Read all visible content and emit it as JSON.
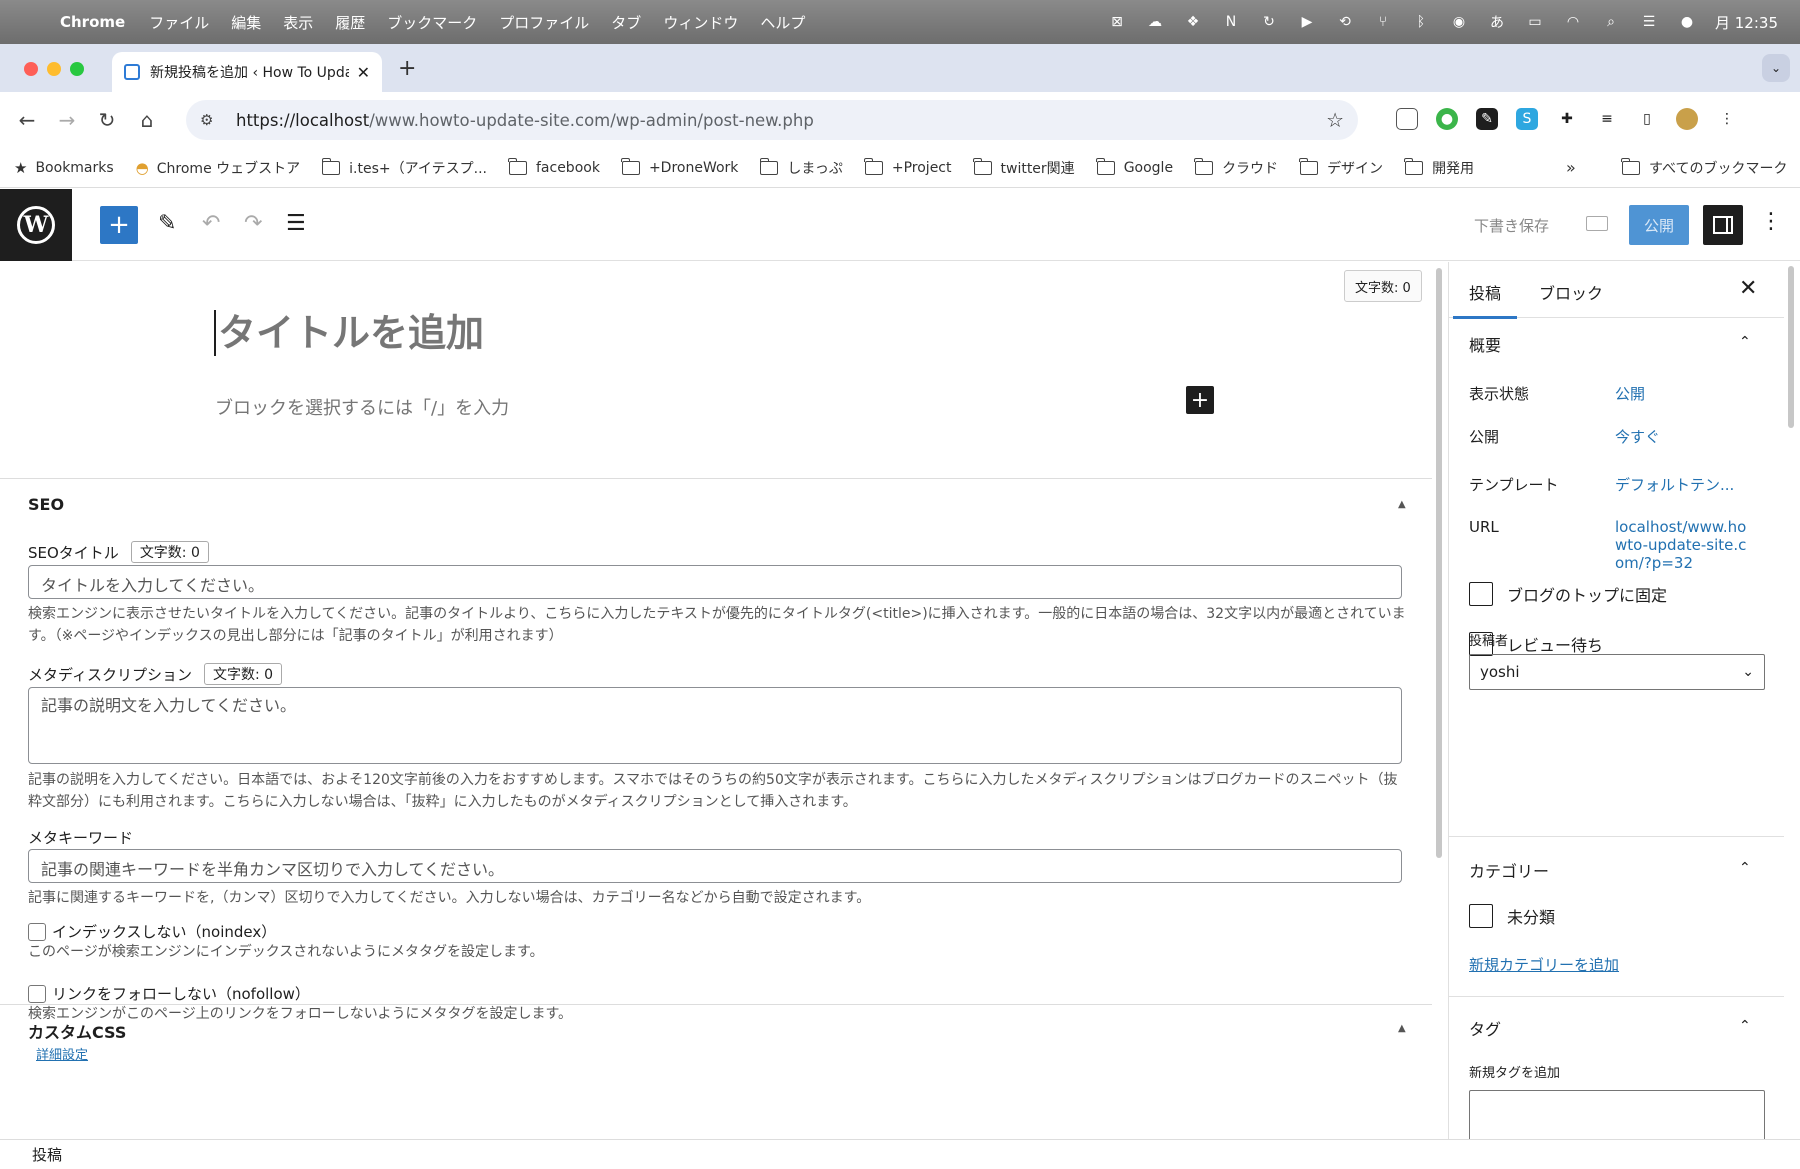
{
  "menubar": {
    "app_name": "Chrome",
    "items": [
      "ファイル",
      "編集",
      "表示",
      "履歴",
      "ブックマーク",
      "プロファイル",
      "タブ",
      "ウィンドウ",
      "ヘルプ"
    ],
    "clock": "月 12:35"
  },
  "browser": {
    "tab_title": "新規投稿を追加 ‹ How To Update",
    "url_host": "https://localhost",
    "url_path": "/www.howto-update-site.com/wp-admin/post-new.php",
    "bookmarks": [
      {
        "label": "Bookmarks",
        "icon": "star-icon"
      },
      {
        "label": "Chrome ウェブストア",
        "icon": "chrome-webstore-icon"
      },
      {
        "label": "i.tes+（アイテスプ...",
        "icon": "folder-icon"
      },
      {
        "label": "facebook",
        "icon": "folder-icon"
      },
      {
        "label": "+DroneWork",
        "icon": "folder-icon"
      },
      {
        "label": "しまっぷ",
        "icon": "folder-icon"
      },
      {
        "label": "+Project",
        "icon": "folder-icon"
      },
      {
        "label": "twitter関連",
        "icon": "folder-icon"
      },
      {
        "label": "Google",
        "icon": "folder-icon"
      },
      {
        "label": "クラウド",
        "icon": "folder-icon"
      },
      {
        "label": "デザイン",
        "icon": "folder-icon"
      },
      {
        "label": "開発用",
        "icon": "folder-icon"
      }
    ],
    "all_bookmarks": "すべてのブックマーク"
  },
  "toolbar": {
    "save_draft": "下書き保存",
    "publish": "公開"
  },
  "editor": {
    "word_count": "文字数: 0",
    "title_placeholder": "タイトルを追加",
    "block_hint": "ブロックを選択するには「/」を入力"
  },
  "seo": {
    "heading": "SEO",
    "title_label": "SEOタイトル",
    "title_count": "文字数: 0",
    "title_placeholder": "タイトルを入力してください。",
    "title_help": "検索エンジンに表示させたいタイトルを入力してください。記事のタイトルより、こちらに入力したテキストが優先的にタイトルタグ(<title>)に挿入されます。一般的に日本語の場合は、32文字以内が最適とされています。（※ページやインデックスの見出し部分には「記事のタイトル」が利用されます）",
    "desc_label": "メタディスクリプション",
    "desc_count": "文字数: 0",
    "desc_placeholder": "記事の説明文を入力してください。",
    "desc_help": "記事の説明を入力してください。日本語では、およそ120文字前後の入力をおすすめします。スマホではそのうちの約50文字が表示されます。こちらに入力したメタディスクリプションはブログカードのスニペット（抜粋文部分）にも利用されます。こちらに入力しない場合は、「抜粋」に入力したものがメタディスクリプションとして挿入されます。",
    "kw_label": "メタキーワード",
    "kw_placeholder": "記事の関連キーワードを半角カンマ区切りで入力してください。",
    "kw_help": "記事に関連するキーワードを,（カンマ）区切りで入力してください。入力しない場合は、カテゴリー名などから自動で設定されます。",
    "noindex_label": "インデックスしない（noindex）",
    "noindex_help": "このページが検索エンジンにインデックスされないようにメタタグを設定します。",
    "nofollow_label": "リンクをフォローしない（nofollow）",
    "nofollow_help": "検索エンジンがこのページ上のリンクをフォローしないようにメタタグを設定します。",
    "advanced_link": "詳細設定"
  },
  "custom_css": {
    "heading": "カスタムCSS"
  },
  "footer": {
    "breadcrumb": "投稿"
  },
  "sidebar": {
    "tab_post": "投稿",
    "tab_block": "ブロック",
    "summary_heading": "概要",
    "visibility_label": "表示状態",
    "visibility_value": "公開",
    "publish_label": "公開",
    "publish_value": "今すぐ",
    "template_label": "テンプレート",
    "template_value": "デフォルトテン...",
    "url_label": "URL",
    "url_value": "localhost/www.howto-update-site.com/?p=32",
    "sticky_label": "ブログのトップに固定",
    "pending_label": "レビュー待ち",
    "author_label": "投稿者",
    "author_value": "yoshi",
    "category_heading": "カテゴリー",
    "category_item": "未分類",
    "add_category": "新規カテゴリーを追加",
    "tag_heading": "タグ",
    "add_tag_label": "新規タグを追加"
  },
  "colors": {
    "accent": "#2d77c5",
    "link": "#2271b1",
    "wp_dark": "#1e1e1e",
    "publish_disabled": "#4f94d4"
  }
}
